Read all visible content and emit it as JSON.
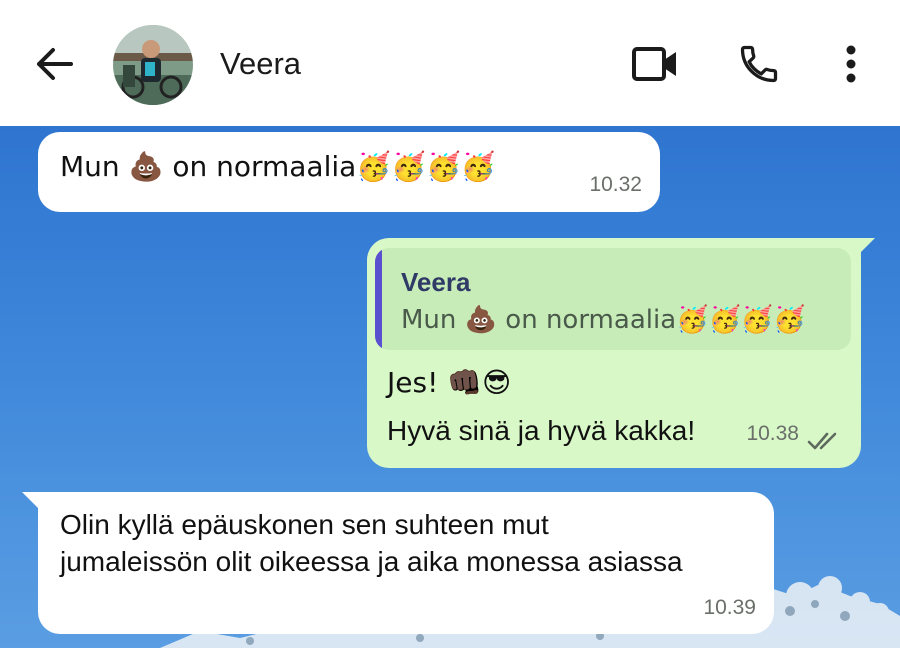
{
  "header": {
    "back_icon": "arrow-left-icon",
    "contact_name": "Veera",
    "video_icon": "video-camera-icon",
    "call_icon": "phone-icon",
    "menu_icon": "more-vert-icon"
  },
  "colors": {
    "header_bg": "#ffffff",
    "chat_bg": "#3a83d8",
    "incoming_bubble": "#ffffff",
    "outgoing_bubble": "#d8f8c8",
    "quote_bar": "#5a4fcf"
  },
  "messages": [
    {
      "direction": "incoming",
      "text": "Mun 💩 on normaalia🥳🥳🥳🥳",
      "time": "10.32"
    },
    {
      "direction": "outgoing",
      "reply_to": {
        "name": "Veera",
        "text": "Mun 💩 on normaalia🥳🥳🥳🥳"
      },
      "line1": "Jes! 👊🏿😎",
      "line2": "Hyvä sinä ja hyvä kakka!",
      "time": "10.38",
      "status_icon": "double-check-icon"
    },
    {
      "direction": "incoming",
      "text": "Olin kyllä epäuskonen sen suhteen mut jumaleissön olit oikeessa ja aika monessa asiassa",
      "time": "10.39"
    }
  ]
}
